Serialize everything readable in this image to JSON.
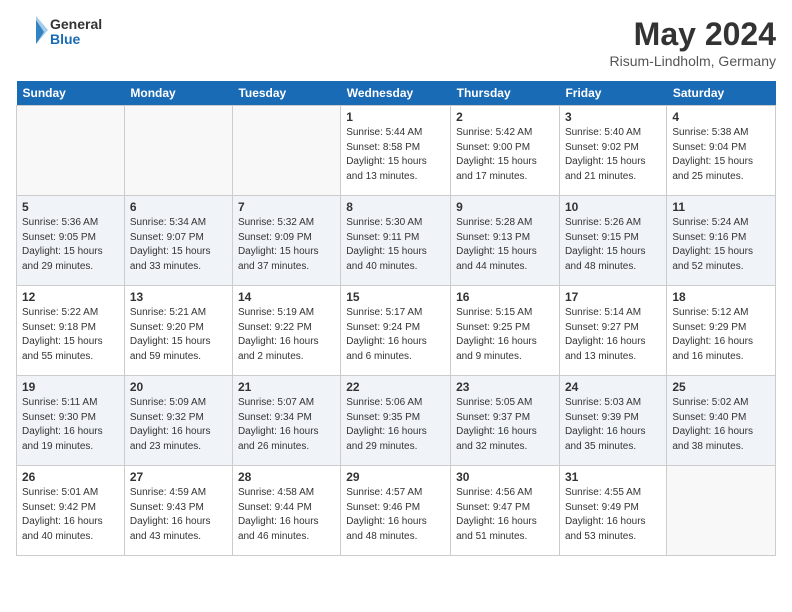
{
  "header": {
    "logo_line1": "General",
    "logo_line2": "Blue",
    "month": "May 2024",
    "location": "Risum-Lindholm, Germany"
  },
  "days_of_week": [
    "Sunday",
    "Monday",
    "Tuesday",
    "Wednesday",
    "Thursday",
    "Friday",
    "Saturday"
  ],
  "weeks": [
    [
      {
        "day": null
      },
      {
        "day": null
      },
      {
        "day": null
      },
      {
        "day": "1",
        "sunrise": "Sunrise: 5:44 AM",
        "sunset": "Sunset: 8:58 PM",
        "daylight": "Daylight: 15 hours and 13 minutes."
      },
      {
        "day": "2",
        "sunrise": "Sunrise: 5:42 AM",
        "sunset": "Sunset: 9:00 PM",
        "daylight": "Daylight: 15 hours and 17 minutes."
      },
      {
        "day": "3",
        "sunrise": "Sunrise: 5:40 AM",
        "sunset": "Sunset: 9:02 PM",
        "daylight": "Daylight: 15 hours and 21 minutes."
      },
      {
        "day": "4",
        "sunrise": "Sunrise: 5:38 AM",
        "sunset": "Sunset: 9:04 PM",
        "daylight": "Daylight: 15 hours and 25 minutes."
      }
    ],
    [
      {
        "day": "5",
        "sunrise": "Sunrise: 5:36 AM",
        "sunset": "Sunset: 9:05 PM",
        "daylight": "Daylight: 15 hours and 29 minutes."
      },
      {
        "day": "6",
        "sunrise": "Sunrise: 5:34 AM",
        "sunset": "Sunset: 9:07 PM",
        "daylight": "Daylight: 15 hours and 33 minutes."
      },
      {
        "day": "7",
        "sunrise": "Sunrise: 5:32 AM",
        "sunset": "Sunset: 9:09 PM",
        "daylight": "Daylight: 15 hours and 37 minutes."
      },
      {
        "day": "8",
        "sunrise": "Sunrise: 5:30 AM",
        "sunset": "Sunset: 9:11 PM",
        "daylight": "Daylight: 15 hours and 40 minutes."
      },
      {
        "day": "9",
        "sunrise": "Sunrise: 5:28 AM",
        "sunset": "Sunset: 9:13 PM",
        "daylight": "Daylight: 15 hours and 44 minutes."
      },
      {
        "day": "10",
        "sunrise": "Sunrise: 5:26 AM",
        "sunset": "Sunset: 9:15 PM",
        "daylight": "Daylight: 15 hours and 48 minutes."
      },
      {
        "day": "11",
        "sunrise": "Sunrise: 5:24 AM",
        "sunset": "Sunset: 9:16 PM",
        "daylight": "Daylight: 15 hours and 52 minutes."
      }
    ],
    [
      {
        "day": "12",
        "sunrise": "Sunrise: 5:22 AM",
        "sunset": "Sunset: 9:18 PM",
        "daylight": "Daylight: 15 hours and 55 minutes."
      },
      {
        "day": "13",
        "sunrise": "Sunrise: 5:21 AM",
        "sunset": "Sunset: 9:20 PM",
        "daylight": "Daylight: 15 hours and 59 minutes."
      },
      {
        "day": "14",
        "sunrise": "Sunrise: 5:19 AM",
        "sunset": "Sunset: 9:22 PM",
        "daylight": "Daylight: 16 hours and 2 minutes."
      },
      {
        "day": "15",
        "sunrise": "Sunrise: 5:17 AM",
        "sunset": "Sunset: 9:24 PM",
        "daylight": "Daylight: 16 hours and 6 minutes."
      },
      {
        "day": "16",
        "sunrise": "Sunrise: 5:15 AM",
        "sunset": "Sunset: 9:25 PM",
        "daylight": "Daylight: 16 hours and 9 minutes."
      },
      {
        "day": "17",
        "sunrise": "Sunrise: 5:14 AM",
        "sunset": "Sunset: 9:27 PM",
        "daylight": "Daylight: 16 hours and 13 minutes."
      },
      {
        "day": "18",
        "sunrise": "Sunrise: 5:12 AM",
        "sunset": "Sunset: 9:29 PM",
        "daylight": "Daylight: 16 hours and 16 minutes."
      }
    ],
    [
      {
        "day": "19",
        "sunrise": "Sunrise: 5:11 AM",
        "sunset": "Sunset: 9:30 PM",
        "daylight": "Daylight: 16 hours and 19 minutes."
      },
      {
        "day": "20",
        "sunrise": "Sunrise: 5:09 AM",
        "sunset": "Sunset: 9:32 PM",
        "daylight": "Daylight: 16 hours and 23 minutes."
      },
      {
        "day": "21",
        "sunrise": "Sunrise: 5:07 AM",
        "sunset": "Sunset: 9:34 PM",
        "daylight": "Daylight: 16 hours and 26 minutes."
      },
      {
        "day": "22",
        "sunrise": "Sunrise: 5:06 AM",
        "sunset": "Sunset: 9:35 PM",
        "daylight": "Daylight: 16 hours and 29 minutes."
      },
      {
        "day": "23",
        "sunrise": "Sunrise: 5:05 AM",
        "sunset": "Sunset: 9:37 PM",
        "daylight": "Daylight: 16 hours and 32 minutes."
      },
      {
        "day": "24",
        "sunrise": "Sunrise: 5:03 AM",
        "sunset": "Sunset: 9:39 PM",
        "daylight": "Daylight: 16 hours and 35 minutes."
      },
      {
        "day": "25",
        "sunrise": "Sunrise: 5:02 AM",
        "sunset": "Sunset: 9:40 PM",
        "daylight": "Daylight: 16 hours and 38 minutes."
      }
    ],
    [
      {
        "day": "26",
        "sunrise": "Sunrise: 5:01 AM",
        "sunset": "Sunset: 9:42 PM",
        "daylight": "Daylight: 16 hours and 40 minutes."
      },
      {
        "day": "27",
        "sunrise": "Sunrise: 4:59 AM",
        "sunset": "Sunset: 9:43 PM",
        "daylight": "Daylight: 16 hours and 43 minutes."
      },
      {
        "day": "28",
        "sunrise": "Sunrise: 4:58 AM",
        "sunset": "Sunset: 9:44 PM",
        "daylight": "Daylight: 16 hours and 46 minutes."
      },
      {
        "day": "29",
        "sunrise": "Sunrise: 4:57 AM",
        "sunset": "Sunset: 9:46 PM",
        "daylight": "Daylight: 16 hours and 48 minutes."
      },
      {
        "day": "30",
        "sunrise": "Sunrise: 4:56 AM",
        "sunset": "Sunset: 9:47 PM",
        "daylight": "Daylight: 16 hours and 51 minutes."
      },
      {
        "day": "31",
        "sunrise": "Sunrise: 4:55 AM",
        "sunset": "Sunset: 9:49 PM",
        "daylight": "Daylight: 16 hours and 53 minutes."
      },
      {
        "day": null
      }
    ]
  ]
}
